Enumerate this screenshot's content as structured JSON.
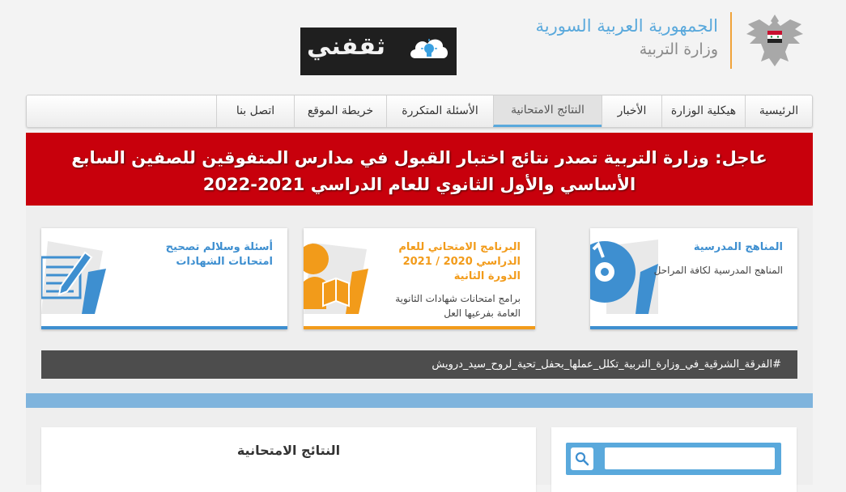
{
  "header": {
    "republic_name": "الجمهورية العربية السورية",
    "ministry_name": "وزارة التربية",
    "logo_text": "ثقفني"
  },
  "nav": {
    "items": [
      {
        "label": "الرئيسية"
      },
      {
        "label": "هيكلية الوزارة"
      },
      {
        "label": "الأخبار"
      },
      {
        "label": "النتائج الامتحانية"
      },
      {
        "label": "الأسئلة المتكررة"
      },
      {
        "label": "خريطة الموقع"
      },
      {
        "label": "اتصل بنا"
      }
    ],
    "active": "النتائج الامتحانية"
  },
  "breaking": {
    "prefix": "عاجل:",
    "text": "وزارة التربية تصدر نتائج اختبار القبول في مدارس المتفوقين للصفين السابع الأساسي والأول الثانوي للعام الدراسي 2021-2022"
  },
  "cards": [
    {
      "title": "المناهج المدرسية",
      "desc": "المناهج المدرسية لكافة المراحل",
      "icon": "disc-icon",
      "color": "#3e8fd0"
    },
    {
      "title": "البرنامج الامتحاني للعام الدراسي 2020 / 2021 الدورة الثانية",
      "desc": "برامج امتحانات شهادات الثانوية العامة بفرعيها العل",
      "icon": "reader-icon",
      "color": "#f29b1a"
    },
    {
      "title": "أسئلة وسلالم تصحيح امتحانات الشهادات",
      "desc": "",
      "icon": "pencil-paper-icon",
      "color": "#3e8fd0"
    }
  ],
  "ticker": {
    "text": "#الفرقة_الشرقية_في_وزارة_التربية_تكلل_عملها_بحفل_تحية_لروح_سيد_درويش"
  },
  "results_panel": {
    "title": "النتائج الامتحانية"
  },
  "search": {
    "placeholder": ""
  },
  "colors": {
    "accent_blue": "#5aa9dc",
    "accent_orange": "#f0a33a",
    "breaking_red": "#c8000c",
    "ticker_bg": "#4d4d4d"
  }
}
